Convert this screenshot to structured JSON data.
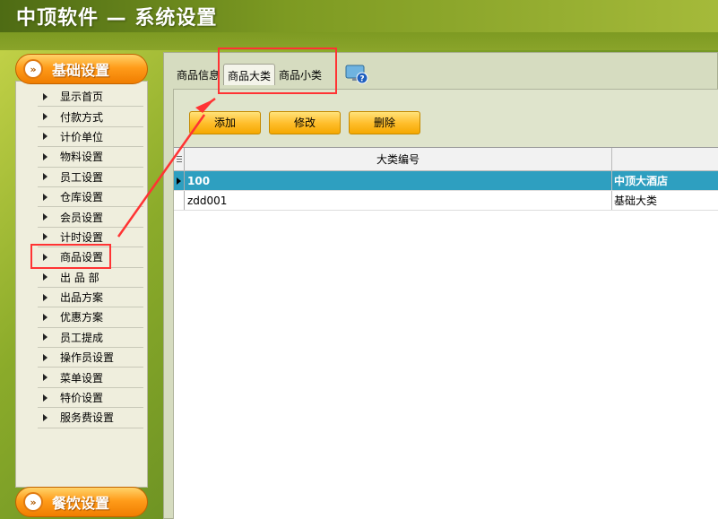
{
  "app": {
    "title": "中顶软件 — 系统设置"
  },
  "sidebar": {
    "sections": [
      {
        "label": "基础设置",
        "bullet": "»"
      },
      {
        "label": "餐饮设置",
        "bullet": "»"
      }
    ],
    "items": [
      {
        "label": "显示首页"
      },
      {
        "label": "付款方式"
      },
      {
        "label": "计价单位"
      },
      {
        "label": "物料设置"
      },
      {
        "label": "员工设置"
      },
      {
        "label": "仓库设置"
      },
      {
        "label": "会员设置"
      },
      {
        "label": "计时设置"
      },
      {
        "label": "商品设置"
      },
      {
        "label": "出 品 部"
      },
      {
        "label": "出品方案"
      },
      {
        "label": "优惠方案"
      },
      {
        "label": "员工提成"
      },
      {
        "label": "操作员设置"
      },
      {
        "label": "菜单设置"
      },
      {
        "label": "特价设置"
      },
      {
        "label": "服务费设置"
      }
    ]
  },
  "tabs": [
    {
      "label": "商品信息"
    },
    {
      "label": "商品大类"
    },
    {
      "label": "商品小类"
    }
  ],
  "toolbar": {
    "add": "添加",
    "edit": "修改",
    "delete": "删除"
  },
  "grid": {
    "columns": [
      "大类编号",
      ""
    ],
    "rows": [
      {
        "code": "100",
        "name": "中顶大酒店"
      },
      {
        "code": "zdd001",
        "name": "基础大类"
      }
    ]
  },
  "colors": {
    "accent": "#ff9c1a",
    "highlight": "#ff3333",
    "selected_row": "#2e9fc0"
  }
}
